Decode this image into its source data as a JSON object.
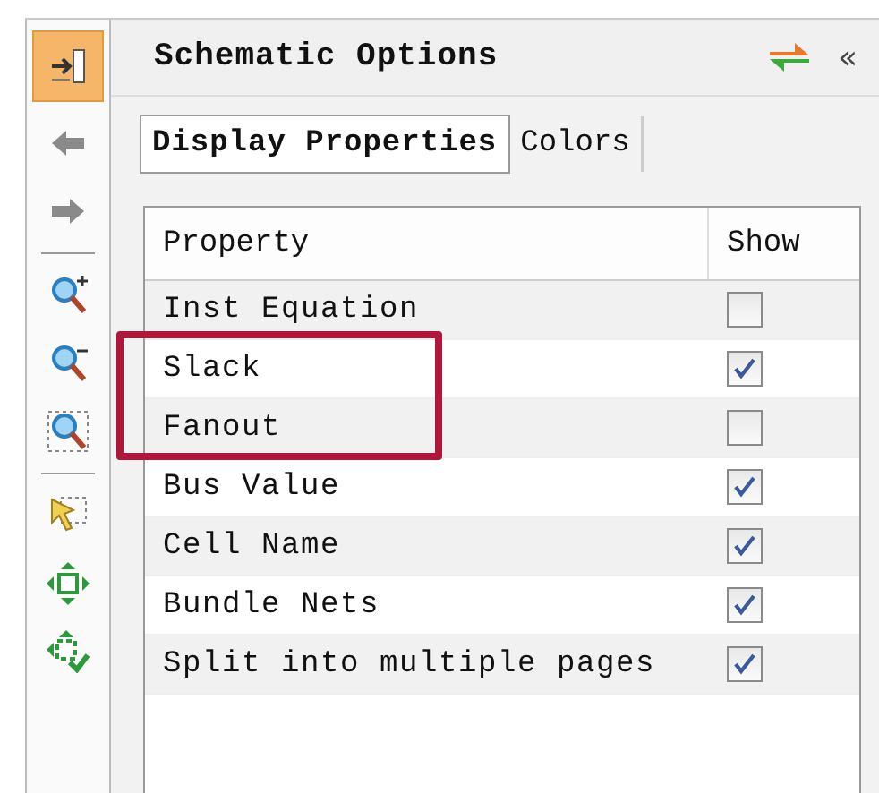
{
  "panel": {
    "title": "Schematic Options",
    "collapse_glyph": "«"
  },
  "tabs": [
    {
      "label": "Display Properties",
      "selected": true
    },
    {
      "label": "Colors",
      "selected": false
    }
  ],
  "table": {
    "columns": [
      "Property",
      "Show"
    ],
    "rows": [
      {
        "property": "Inst Equation",
        "checked": false,
        "highlighted": false
      },
      {
        "property": "Slack",
        "checked": true,
        "highlighted": true
      },
      {
        "property": "Fanout",
        "checked": false,
        "highlighted": true
      },
      {
        "property": "Bus Value",
        "checked": true,
        "highlighted": false
      },
      {
        "property": "Cell Name",
        "checked": true,
        "highlighted": false
      },
      {
        "property": "Bundle Nets",
        "checked": true,
        "highlighted": false
      },
      {
        "property": "Split into multiple pages",
        "checked": true,
        "highlighted": false
      }
    ]
  }
}
